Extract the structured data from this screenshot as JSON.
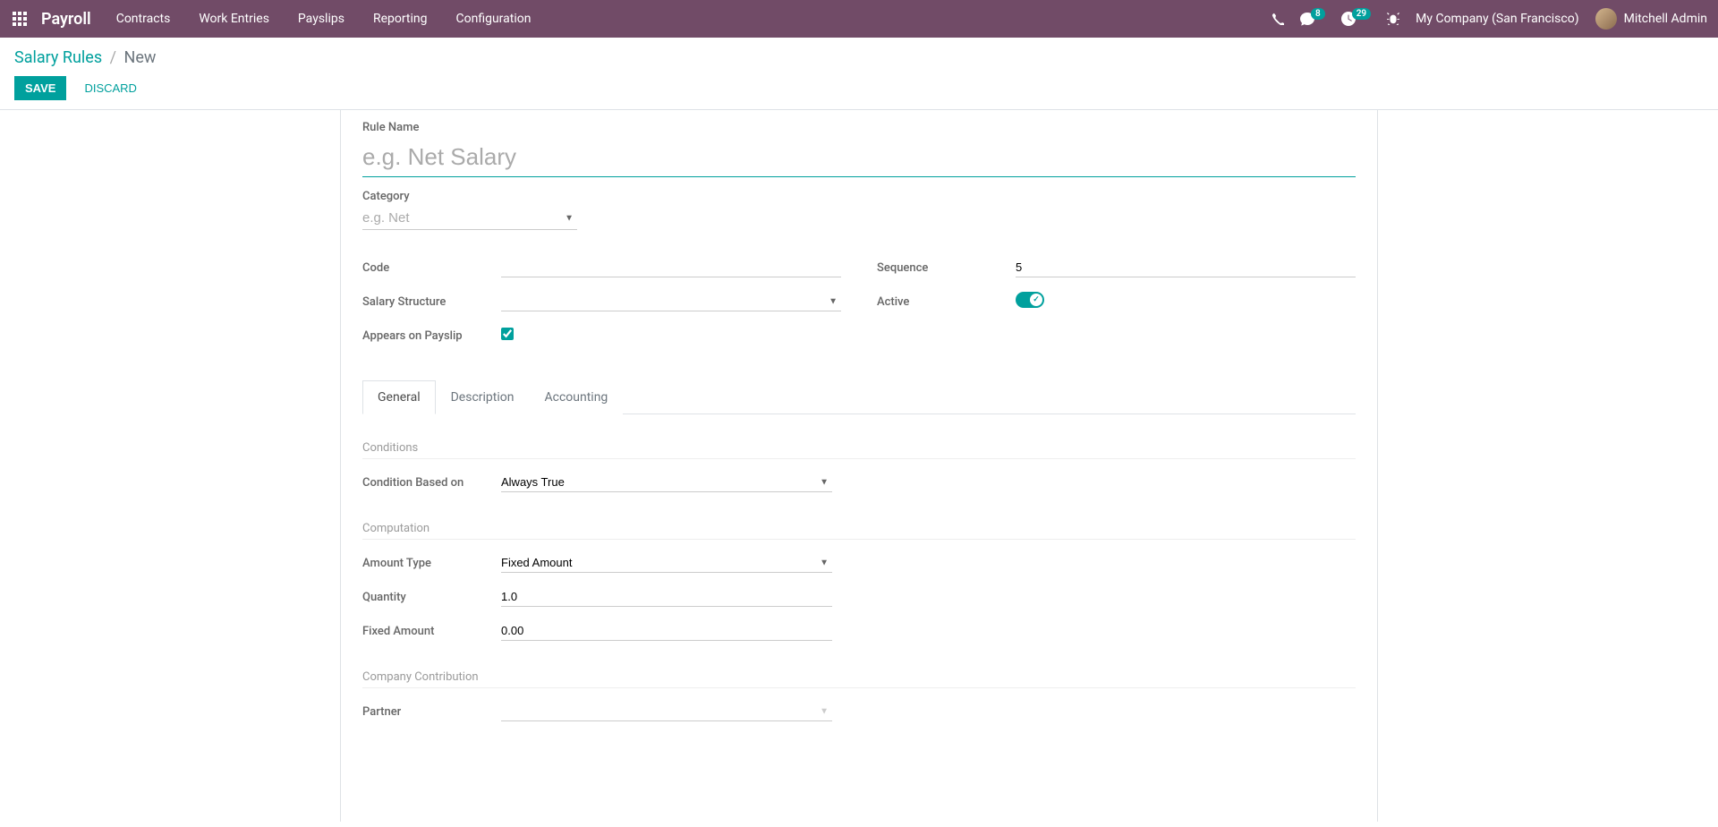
{
  "header": {
    "brand": "Payroll",
    "menu": [
      "Contracts",
      "Work Entries",
      "Payslips",
      "Reporting",
      "Configuration"
    ],
    "messages_badge": "8",
    "activities_badge": "29",
    "company": "My Company (San Francisco)",
    "user": "Mitchell Admin"
  },
  "breadcrumb": {
    "parent": "Salary Rules",
    "current": "New"
  },
  "actions": {
    "save": "SAVE",
    "discard": "DISCARD"
  },
  "form": {
    "rule_name_label": "Rule Name",
    "rule_name_placeholder": "e.g. Net Salary",
    "category_label": "Category",
    "category_placeholder": "e.g. Net",
    "left_fields": {
      "code": "Code",
      "salary_structure": "Salary Structure",
      "appears_on_payslip": "Appears on Payslip"
    },
    "right_fields": {
      "sequence": "Sequence",
      "sequence_value": "5",
      "active": "Active"
    }
  },
  "tabs": [
    "General",
    "Description",
    "Accounting"
  ],
  "sections": {
    "conditions": {
      "title": "Conditions",
      "condition_based_on_label": "Condition Based on",
      "condition_based_on_value": "Always True"
    },
    "computation": {
      "title": "Computation",
      "amount_type_label": "Amount Type",
      "amount_type_value": "Fixed Amount",
      "quantity_label": "Quantity",
      "quantity_value": "1.0",
      "fixed_amount_label": "Fixed Amount",
      "fixed_amount_value": "0.00"
    },
    "company_contribution": {
      "title": "Company Contribution",
      "partner_label": "Partner"
    }
  }
}
